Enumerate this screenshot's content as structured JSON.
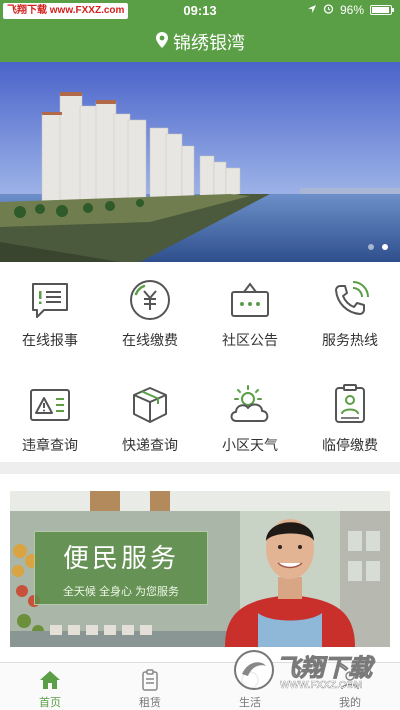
{
  "status_bar": {
    "watermark": "飞翔下载 www.FXXZ.com",
    "time": "09:13",
    "battery": "96%"
  },
  "header": {
    "location": "锦绣银湾",
    "location_icon": "location-pin-icon"
  },
  "banner": {
    "slide_count": 2,
    "active_slide": 2
  },
  "services": [
    {
      "label": "在线报事",
      "icon": "report-chat-icon"
    },
    {
      "label": "在线缴费",
      "icon": "yuan-payment-icon"
    },
    {
      "label": "社区公告",
      "icon": "notice-board-icon"
    },
    {
      "label": "服务热线",
      "icon": "phone-icon"
    },
    {
      "label": "违章查询",
      "icon": "warning-card-icon"
    },
    {
      "label": "快递查询",
      "icon": "package-icon"
    },
    {
      "label": "小区天气",
      "icon": "weather-icon"
    },
    {
      "label": "临停缴费",
      "icon": "parking-badge-icon"
    }
  ],
  "promo": {
    "title": "便民服务",
    "subtitle": "全天候 全身心 为您服务"
  },
  "tabbar": {
    "tabs": [
      {
        "label": "首页",
        "icon": "home-icon",
        "active": true
      },
      {
        "label": "租赁",
        "icon": "clipboard-icon",
        "active": false
      },
      {
        "label": "生活",
        "icon": "life-icon",
        "active": false
      },
      {
        "label": "我的",
        "icon": "user-icon",
        "active": false
      }
    ]
  },
  "overlay_watermark": {
    "text": "飞翔下载",
    "url": "WWW.FXXZ.COM"
  },
  "colors": {
    "brand_green": "#5a9e45",
    "icon_gray": "#555555"
  }
}
